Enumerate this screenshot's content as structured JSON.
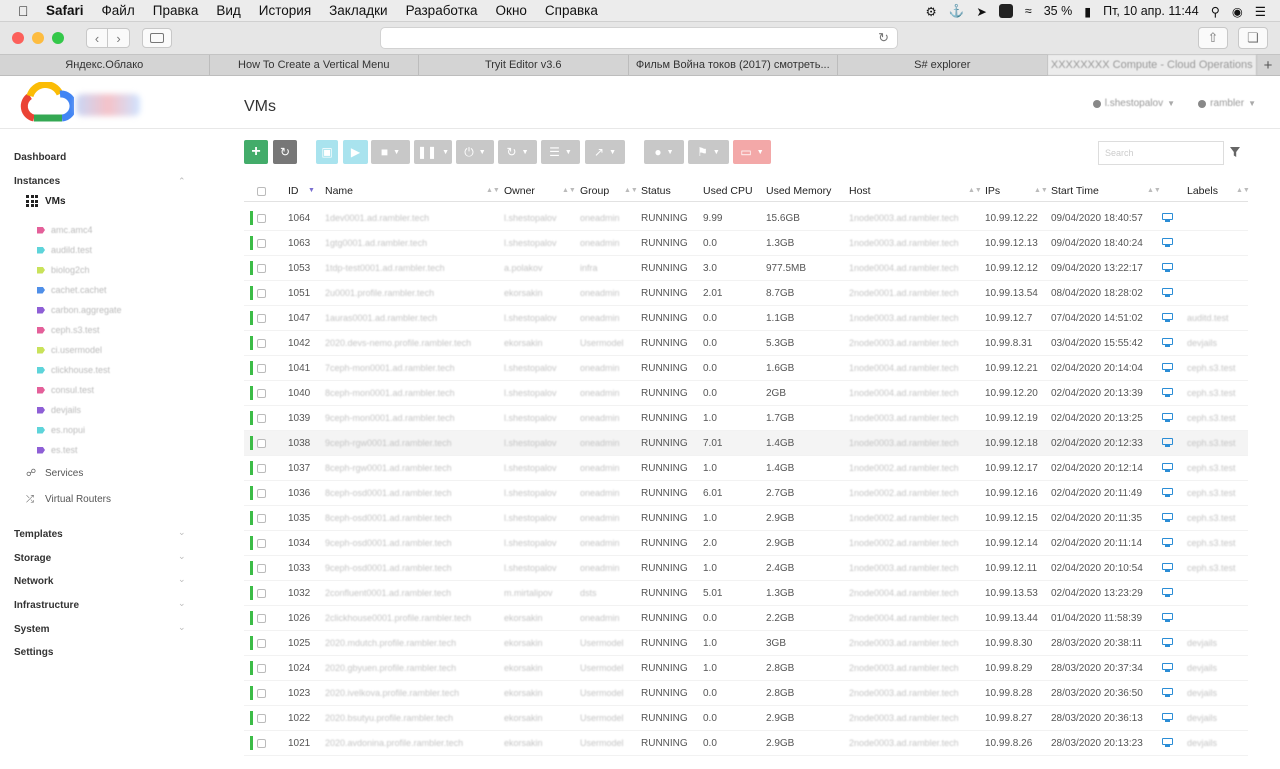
{
  "menubar": {
    "items": [
      "Safari",
      "Файл",
      "Правка",
      "Вид",
      "История",
      "Закладки",
      "Разработка",
      "Окно",
      "Справка"
    ],
    "battery": "35 %",
    "datetime": "Пт, 10 апр.  11:44"
  },
  "tabs": [
    "Яндекс.Облако",
    "How To Create a Vertical Menu",
    "Tryit Editor v3.6",
    "Фильм Война токов (2017) смотреть...",
    "S# explorer",
    "XXXXXXXX Compute - Cloud Operations"
  ],
  "page": {
    "title": "VMs",
    "user": "l.shestopalov",
    "zone": "rambler",
    "search_placeholder": "Search"
  },
  "sidebar": {
    "dashboard": "Dashboard",
    "instances": "Instances",
    "vms": "VMs",
    "tags": [
      {
        "label": "amc.amc4",
        "color": "#e4609a"
      },
      {
        "label": "audild.test",
        "color": "#5ed4da"
      },
      {
        "label": "biolog2ch",
        "color": "#c9e25a"
      },
      {
        "label": "cachet.cachet",
        "color": "#4f8fe8"
      },
      {
        "label": "carbon.aggregate",
        "color": "#8e5fd6"
      },
      {
        "label": "ceph.s3.test",
        "color": "#e4609a"
      },
      {
        "label": "ci.usermodel",
        "color": "#c9e25a"
      },
      {
        "label": "clickhouse.test",
        "color": "#5ed4da"
      },
      {
        "label": "consul.test",
        "color": "#e4609a"
      },
      {
        "label": "devjails",
        "color": "#8e5fd6"
      },
      {
        "label": "es.nopui",
        "color": "#5ed4da"
      },
      {
        "label": "es.test",
        "color": "#8e5fd6"
      }
    ],
    "services": "Services",
    "virtual_routers": "Virtual Routers",
    "templates": "Templates",
    "storage": "Storage",
    "network": "Network",
    "infrastructure": "Infrastructure",
    "system": "System",
    "settings": "Settings"
  },
  "columns": {
    "id": "ID",
    "name": "Name",
    "owner": "Owner",
    "group": "Group",
    "status": "Status",
    "cpu": "Used CPU",
    "memory": "Used Memory",
    "host": "Host",
    "ips": "IPs",
    "start": "Start Time",
    "labels": "Labels"
  },
  "rows": [
    {
      "id": "1064",
      "name": "1dev0001.ad.rambler.tech",
      "owner": "l.shestopalov",
      "group": "oneadmin",
      "status": "RUNNING",
      "cpu": "9.99",
      "mem": "15.6GB",
      "host": "1node0003.ad.rambler.tech",
      "ip": "10.99.12.22",
      "start": "09/04/2020 18:40:57",
      "label": ""
    },
    {
      "id": "1063",
      "name": "1gtg0001.ad.rambler.tech",
      "owner": "l.shestopalov",
      "group": "oneadmin",
      "status": "RUNNING",
      "cpu": "0.0",
      "mem": "1.3GB",
      "host": "1node0003.ad.rambler.tech",
      "ip": "10.99.12.13",
      "start": "09/04/2020 18:40:24",
      "label": ""
    },
    {
      "id": "1053",
      "name": "1tdp-test0001.ad.rambler.tech",
      "owner": "a.polakov",
      "group": "infra",
      "status": "RUNNING",
      "cpu": "3.0",
      "mem": "977.5MB",
      "host": "1node0004.ad.rambler.tech",
      "ip": "10.99.12.12",
      "start": "09/04/2020 13:22:17",
      "label": ""
    },
    {
      "id": "1051",
      "name": "2u0001.profile.rambler.tech",
      "owner": "ekorsakin",
      "group": "oneadmin",
      "status": "RUNNING",
      "cpu": "2.01",
      "mem": "8.7GB",
      "host": "2node0001.ad.rambler.tech",
      "ip": "10.99.13.54",
      "start": "08/04/2020 18:28:02",
      "label": ""
    },
    {
      "id": "1047",
      "name": "1auras0001.ad.rambler.tech",
      "owner": "l.shestopalov",
      "group": "oneadmin",
      "status": "RUNNING",
      "cpu": "0.0",
      "mem": "1.1GB",
      "host": "1node0003.ad.rambler.tech",
      "ip": "10.99.12.7",
      "start": "07/04/2020 14:51:02",
      "label": "auditd.test"
    },
    {
      "id": "1042",
      "name": "2020.devs-nemo.profile.rambler.tech",
      "owner": "ekorsakin",
      "group": "Usermodel",
      "status": "RUNNING",
      "cpu": "0.0",
      "mem": "5.3GB",
      "host": "2node0003.ad.rambler.tech",
      "ip": "10.99.8.31",
      "start": "03/04/2020 15:55:42",
      "label": "devjails"
    },
    {
      "id": "1041",
      "name": "7ceph-mon0001.ad.rambler.tech",
      "owner": "l.shestopalov",
      "group": "oneadmin",
      "status": "RUNNING",
      "cpu": "0.0",
      "mem": "1.6GB",
      "host": "1node0004.ad.rambler.tech",
      "ip": "10.99.12.21",
      "start": "02/04/2020 20:14:04",
      "label": "ceph.s3.test"
    },
    {
      "id": "1040",
      "name": "8ceph-mon0001.ad.rambler.tech",
      "owner": "l.shestopalov",
      "group": "oneadmin",
      "status": "RUNNING",
      "cpu": "0.0",
      "mem": "2GB",
      "host": "1node0004.ad.rambler.tech",
      "ip": "10.99.12.20",
      "start": "02/04/2020 20:13:39",
      "label": "ceph.s3.test"
    },
    {
      "id": "1039",
      "name": "9ceph-mon0001.ad.rambler.tech",
      "owner": "l.shestopalov",
      "group": "oneadmin",
      "status": "RUNNING",
      "cpu": "1.0",
      "mem": "1.7GB",
      "host": "1node0003.ad.rambler.tech",
      "ip": "10.99.12.19",
      "start": "02/04/2020 20:13:25",
      "label": "ceph.s3.test"
    },
    {
      "id": "1038",
      "name": "9ceph-rgw0001.ad.rambler.tech",
      "owner": "l.shestopalov",
      "group": "oneadmin",
      "status": "RUNNING",
      "cpu": "7.01",
      "mem": "1.4GB",
      "host": "1node0003.ad.rambler.tech",
      "ip": "10.99.12.18",
      "start": "02/04/2020 20:12:33",
      "label": "ceph.s3.test"
    },
    {
      "id": "1037",
      "name": "8ceph-rgw0001.ad.rambler.tech",
      "owner": "l.shestopalov",
      "group": "oneadmin",
      "status": "RUNNING",
      "cpu": "1.0",
      "mem": "1.4GB",
      "host": "1node0002.ad.rambler.tech",
      "ip": "10.99.12.17",
      "start": "02/04/2020 20:12:14",
      "label": "ceph.s3.test"
    },
    {
      "id": "1036",
      "name": "8ceph-osd0001.ad.rambler.tech",
      "owner": "l.shestopalov",
      "group": "oneadmin",
      "status": "RUNNING",
      "cpu": "6.01",
      "mem": "2.7GB",
      "host": "1node0002.ad.rambler.tech",
      "ip": "10.99.12.16",
      "start": "02/04/2020 20:11:49",
      "label": "ceph.s3.test"
    },
    {
      "id": "1035",
      "name": "8ceph-osd0001.ad.rambler.tech",
      "owner": "l.shestopalov",
      "group": "oneadmin",
      "status": "RUNNING",
      "cpu": "1.0",
      "mem": "2.9GB",
      "host": "1node0002.ad.rambler.tech",
      "ip": "10.99.12.15",
      "start": "02/04/2020 20:11:35",
      "label": "ceph.s3.test"
    },
    {
      "id": "1034",
      "name": "9ceph-osd0001.ad.rambler.tech",
      "owner": "l.shestopalov",
      "group": "oneadmin",
      "status": "RUNNING",
      "cpu": "2.0",
      "mem": "2.9GB",
      "host": "1node0002.ad.rambler.tech",
      "ip": "10.99.12.14",
      "start": "02/04/2020 20:11:14",
      "label": "ceph.s3.test"
    },
    {
      "id": "1033",
      "name": "9ceph-osd0001.ad.rambler.tech",
      "owner": "l.shestopalov",
      "group": "oneadmin",
      "status": "RUNNING",
      "cpu": "1.0",
      "mem": "2.4GB",
      "host": "1node0003.ad.rambler.tech",
      "ip": "10.99.12.11",
      "start": "02/04/2020 20:10:54",
      "label": "ceph.s3.test"
    },
    {
      "id": "1032",
      "name": "2confluent0001.ad.rambler.tech",
      "owner": "m.mirtalipov",
      "group": "dsts",
      "status": "RUNNING",
      "cpu": "5.01",
      "mem": "1.3GB",
      "host": "2node0004.ad.rambler.tech",
      "ip": "10.99.13.53",
      "start": "02/04/2020 13:23:29",
      "label": ""
    },
    {
      "id": "1026",
      "name": "2clickhouse0001.profile.rambler.tech",
      "owner": "ekorsakin",
      "group": "oneadmin",
      "status": "RUNNING",
      "cpu": "0.0",
      "mem": "2.2GB",
      "host": "2node0004.ad.rambler.tech",
      "ip": "10.99.13.44",
      "start": "01/04/2020 11:58:39",
      "label": ""
    },
    {
      "id": "1025",
      "name": "2020.mdutch.profile.rambler.tech",
      "owner": "ekorsakin",
      "group": "Usermodel",
      "status": "RUNNING",
      "cpu": "1.0",
      "mem": "3GB",
      "host": "2node0003.ad.rambler.tech",
      "ip": "10.99.8.30",
      "start": "28/03/2020 20:38:11",
      "label": "devjails"
    },
    {
      "id": "1024",
      "name": "2020.gbyuen.profile.rambler.tech",
      "owner": "ekorsakin",
      "group": "Usermodel",
      "status": "RUNNING",
      "cpu": "1.0",
      "mem": "2.8GB",
      "host": "2node0003.ad.rambler.tech",
      "ip": "10.99.8.29",
      "start": "28/03/2020 20:37:34",
      "label": "devjails"
    },
    {
      "id": "1023",
      "name": "2020.ivelkova.profile.rambler.tech",
      "owner": "ekorsakin",
      "group": "Usermodel",
      "status": "RUNNING",
      "cpu": "0.0",
      "mem": "2.8GB",
      "host": "2node0003.ad.rambler.tech",
      "ip": "10.99.8.28",
      "start": "28/03/2020 20:36:50",
      "label": "devjails"
    },
    {
      "id": "1022",
      "name": "2020.bsutyu.profile.rambler.tech",
      "owner": "ekorsakin",
      "group": "Usermodel",
      "status": "RUNNING",
      "cpu": "0.0",
      "mem": "2.9GB",
      "host": "2node0003.ad.rambler.tech",
      "ip": "10.99.8.27",
      "start": "28/03/2020 20:36:13",
      "label": "devjails"
    },
    {
      "id": "1021",
      "name": "2020.avdonina.profile.rambler.tech",
      "owner": "ekorsakin",
      "group": "Usermodel",
      "status": "RUNNING",
      "cpu": "0.0",
      "mem": "2.9GB",
      "host": "2node0003.ad.rambler.tech",
      "ip": "10.99.8.26",
      "start": "28/03/2020 20:13:23",
      "label": "devjails"
    }
  ]
}
